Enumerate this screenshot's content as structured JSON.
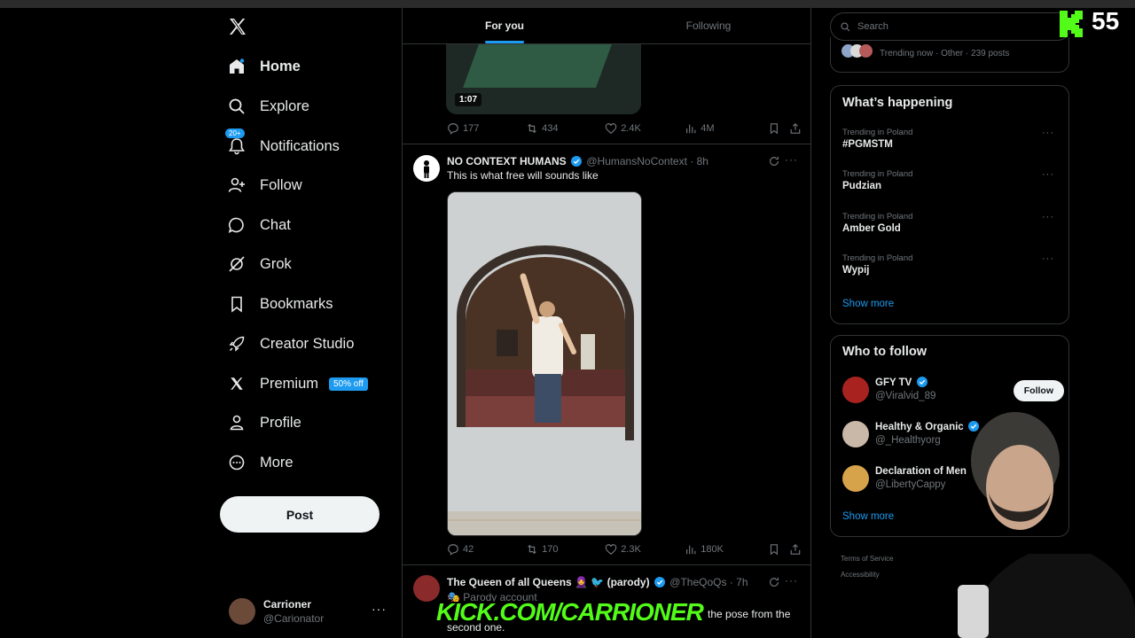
{
  "nav": {
    "items": [
      {
        "label": "Home",
        "icon": "home-icon"
      },
      {
        "label": "Explore",
        "icon": "search-icon"
      },
      {
        "label": "Notifications",
        "icon": "bell-icon",
        "badge": "20+"
      },
      {
        "label": "Follow",
        "icon": "person-add-icon"
      },
      {
        "label": "Chat",
        "icon": "chat-icon"
      },
      {
        "label": "Grok",
        "icon": "grok-icon"
      },
      {
        "label": "Bookmarks",
        "icon": "bookmark-icon"
      },
      {
        "label": "Creator Studio",
        "icon": "rocket-icon"
      },
      {
        "label": "Premium",
        "icon": "x-icon",
        "promo": "50% off"
      },
      {
        "label": "Profile",
        "icon": "person-icon"
      },
      {
        "label": "More",
        "icon": "more-circle-icon"
      }
    ],
    "post_label": "Post",
    "account": {
      "name": "Carrioner",
      "handle": "@Carionator",
      "more": "···"
    }
  },
  "feed": {
    "tabs": [
      "For you",
      "Following"
    ],
    "tweet0": {
      "duration": "1:07",
      "stats": {
        "replies": "177",
        "reposts": "434",
        "likes": "2.4K",
        "views": "4M"
      }
    },
    "tweet1": {
      "name": "NO CONTEXT HUMANS",
      "handle": "@HumansNoContext",
      "time": "· 8h",
      "text": "This is what free will sounds like",
      "stats": {
        "replies": "42",
        "reposts": "170",
        "likes": "2.3K",
        "views": "180K"
      }
    },
    "tweet2": {
      "name": "The Queen of all Queens 🧕 🐦 (parody)",
      "handle": "@TheQoQs",
      "time": "· 7h",
      "sub": "🎭 Parody account",
      "text_end": "the pose from the",
      "text_line2": "second one."
    }
  },
  "right": {
    "search_placeholder": "Search",
    "trending_now": "Trending now · Other · 239 posts",
    "whats_happening": {
      "title": "What’s happening",
      "trends": [
        {
          "context": "Trending in Poland",
          "title": "#PGMSTM"
        },
        {
          "context": "Trending in Poland",
          "title": "Pudzian"
        },
        {
          "context": "Trending in Poland",
          "title": "Amber Gold"
        },
        {
          "context": "Trending in Poland",
          "title": "Wypij"
        }
      ],
      "show_more": "Show more"
    },
    "who_to_follow": {
      "title": "Who to follow",
      "accounts": [
        {
          "name": "GFY TV",
          "handle": "@Viralvid_89",
          "button": "Follow"
        },
        {
          "name": "Healthy & Organic",
          "handle": "@_Healthyorg"
        },
        {
          "name": "Declaration of Men",
          "handle": "@LibertyCappy"
        }
      ],
      "show_more": "Show more"
    },
    "footer": [
      "Terms of Service",
      "Accessibility"
    ]
  },
  "overlay": {
    "kick_count": "55",
    "kick_url": "KICK.COM/CARRIONER"
  },
  "colors": {
    "accent": "#1d9bf0",
    "kick": "#53fc18",
    "background": "#000000"
  }
}
